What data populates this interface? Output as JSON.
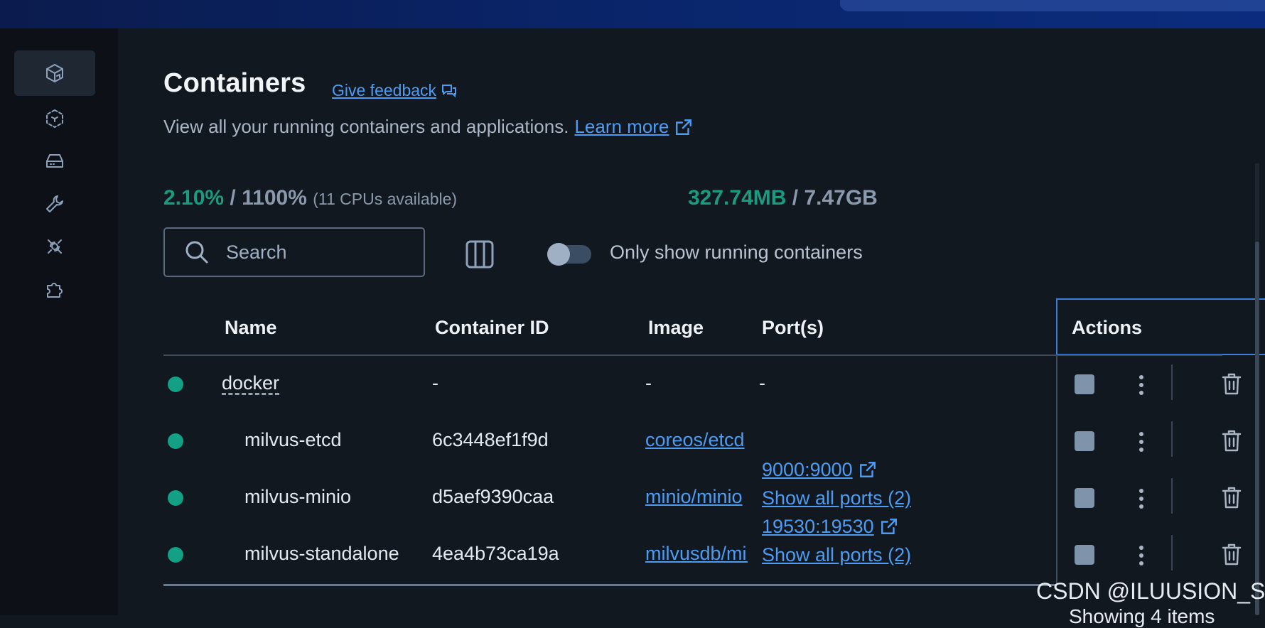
{
  "topbar": {
    "search_area": ""
  },
  "sidebar": {
    "items": [
      {
        "id": "containers",
        "icon": "cube-icon",
        "active": true
      },
      {
        "id": "images",
        "icon": "dotted-cube-icon"
      },
      {
        "id": "volumes",
        "icon": "hard-drive-icon"
      },
      {
        "id": "builds",
        "icon": "wrench-icon"
      },
      {
        "id": "scout",
        "icon": "radar-icon"
      },
      {
        "id": "extensions",
        "icon": "puzzle-icon"
      }
    ]
  },
  "header": {
    "title": "Containers",
    "feedback_label": "Give feedback",
    "subtitle": "View all your running containers and applications.",
    "learn_more": "Learn more"
  },
  "stats": {
    "cpu_used": "2.10%",
    "cpu_sep": "/",
    "cpu_total": "1100%",
    "cpu_note": "(11 CPUs available)",
    "mem_used": "327.74MB",
    "mem_sep": "/",
    "mem_total": "7.47GB"
  },
  "toolbar": {
    "search_placeholder": "Search",
    "toggle_label": "Only show running containers",
    "toggle_on": false
  },
  "table": {
    "headers": {
      "name": "Name",
      "container_id": "Container ID",
      "image": "Image",
      "ports": "Port(s)",
      "actions": "Actions"
    },
    "rows": [
      {
        "name": "docker",
        "container_id": "-",
        "image": "-",
        "ports": "-",
        "status": "running"
      },
      {
        "name": "milvus-etcd",
        "container_id": "6c3448ef1f9d",
        "image": "coreos/etcd",
        "status": "running"
      },
      {
        "name": "milvus-minio",
        "container_id": "d5aef9390caa",
        "image": "minio/minio",
        "port": "9000:9000",
        "show_all": "Show all ports (2)",
        "status": "running"
      },
      {
        "name": "milvus-standalone",
        "container_id": "4ea4b73ca19a",
        "image": "milvusdb/milvus",
        "port": "19530:19530",
        "show_all": "Show all ports (2)",
        "status": "running"
      }
    ]
  },
  "watermark": "CSDN @ILUUSION_S",
  "footer_partial": "Showing 4 items",
  "colors": {
    "accent": "#4d9cf2",
    "running": "#14a085",
    "background": "#121820"
  }
}
